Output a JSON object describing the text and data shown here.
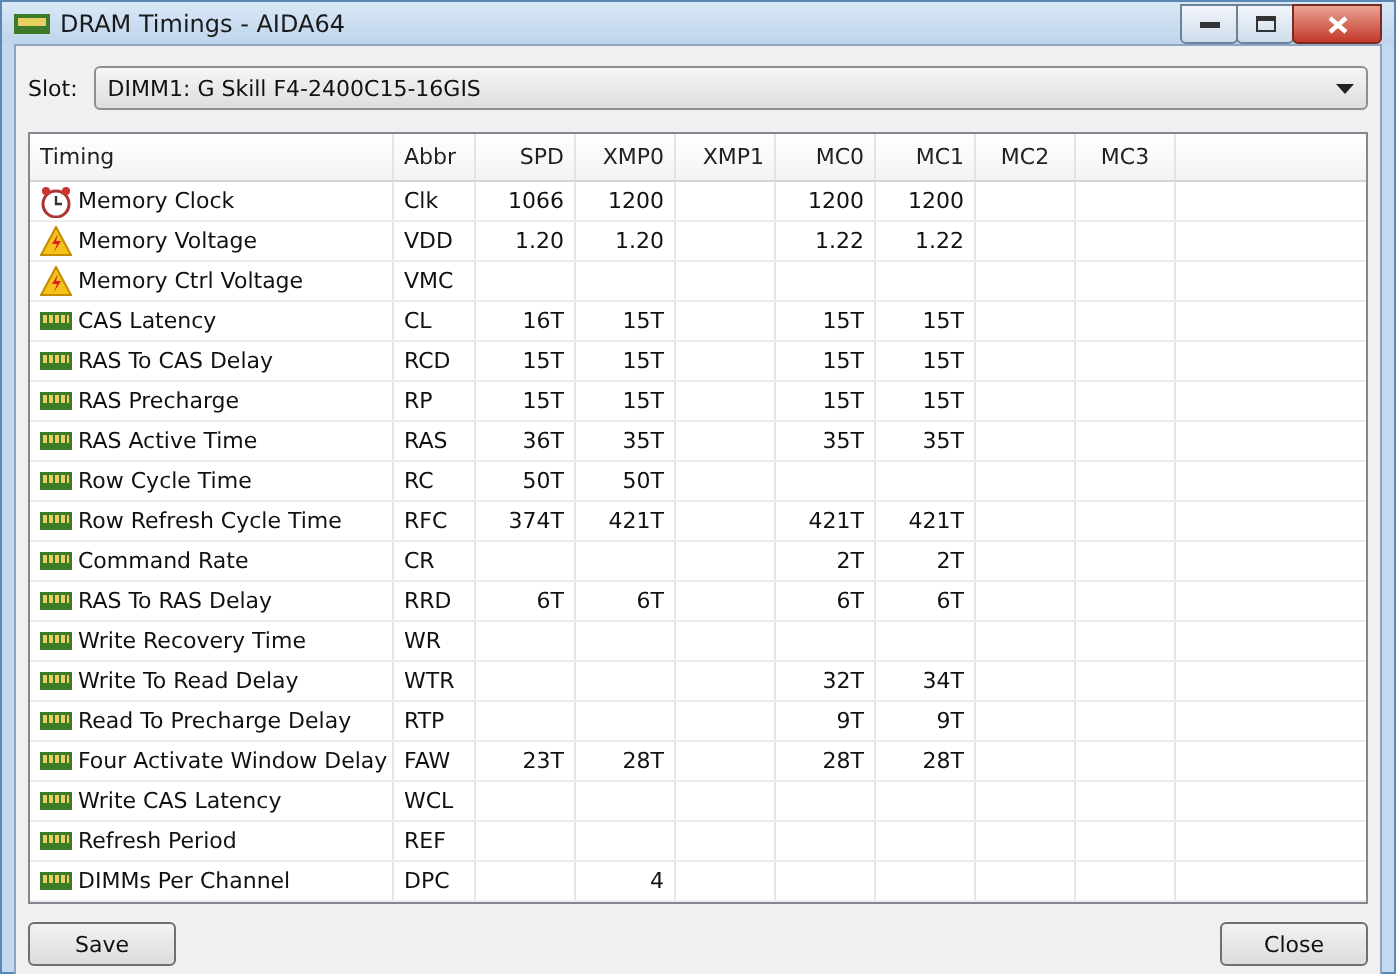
{
  "window": {
    "title": "DRAM Timings - AIDA64"
  },
  "slot": {
    "label": "Slot:",
    "value": "DIMM1: G Skill F4-2400C15-16GIS"
  },
  "table": {
    "columns": [
      "Timing",
      "Abbr",
      "SPD",
      "XMP0",
      "XMP1",
      "MC0",
      "MC1",
      "MC2",
      "MC3"
    ],
    "rows": [
      {
        "kind": "clock",
        "cells": [
          "Memory Clock",
          "Clk",
          "1066",
          "1200",
          "",
          "1200",
          "1200",
          "",
          ""
        ]
      },
      {
        "kind": "warning",
        "cells": [
          "Memory Voltage",
          "VDD",
          "1.20",
          "1.20",
          "",
          "1.22",
          "1.22",
          "",
          ""
        ]
      },
      {
        "kind": "warning",
        "cells": [
          "Memory Ctrl Voltage",
          "VMC",
          "",
          "",
          "",
          "",
          "",
          "",
          ""
        ]
      },
      {
        "kind": "memory",
        "cells": [
          "CAS Latency",
          "CL",
          "16T",
          "15T",
          "",
          "15T",
          "15T",
          "",
          ""
        ]
      },
      {
        "kind": "memory",
        "cells": [
          "RAS To CAS Delay",
          "RCD",
          "15T",
          "15T",
          "",
          "15T",
          "15T",
          "",
          ""
        ]
      },
      {
        "kind": "memory",
        "cells": [
          "RAS Precharge",
          "RP",
          "15T",
          "15T",
          "",
          "15T",
          "15T",
          "",
          ""
        ]
      },
      {
        "kind": "memory",
        "cells": [
          "RAS Active Time",
          "RAS",
          "36T",
          "35T",
          "",
          "35T",
          "35T",
          "",
          ""
        ]
      },
      {
        "kind": "memory",
        "cells": [
          "Row Cycle Time",
          "RC",
          "50T",
          "50T",
          "",
          "",
          "",
          "",
          ""
        ]
      },
      {
        "kind": "memory",
        "cells": [
          "Row Refresh Cycle Time",
          "RFC",
          "374T",
          "421T",
          "",
          "421T",
          "421T",
          "",
          ""
        ]
      },
      {
        "kind": "memory",
        "cells": [
          "Command Rate",
          "CR",
          "",
          "",
          "",
          "2T",
          "2T",
          "",
          ""
        ]
      },
      {
        "kind": "memory",
        "cells": [
          "RAS To RAS Delay",
          "RRD",
          "6T",
          "6T",
          "",
          "6T",
          "6T",
          "",
          ""
        ]
      },
      {
        "kind": "memory",
        "cells": [
          "Write Recovery Time",
          "WR",
          "",
          "",
          "",
          "",
          "",
          "",
          ""
        ]
      },
      {
        "kind": "memory",
        "cells": [
          "Write To Read Delay",
          "WTR",
          "",
          "",
          "",
          "32T",
          "34T",
          "",
          ""
        ]
      },
      {
        "kind": "memory",
        "cells": [
          "Read To Precharge Delay",
          "RTP",
          "",
          "",
          "",
          "9T",
          "9T",
          "",
          ""
        ]
      },
      {
        "kind": "memory",
        "cells": [
          "Four Activate Window Delay",
          "FAW",
          "23T",
          "28T",
          "",
          "28T",
          "28T",
          "",
          ""
        ]
      },
      {
        "kind": "memory",
        "cells": [
          "Write CAS Latency",
          "WCL",
          "",
          "",
          "",
          "",
          "",
          "",
          ""
        ]
      },
      {
        "kind": "memory",
        "cells": [
          "Refresh Period",
          "REF",
          "",
          "",
          "",
          "",
          "",
          "",
          ""
        ]
      },
      {
        "kind": "memory",
        "cells": [
          "DIMMs Per Channel",
          "DPC",
          "",
          "4",
          "",
          "",
          "",
          "",
          ""
        ]
      }
    ]
  },
  "buttons": [
    "Save",
    "Close"
  ]
}
